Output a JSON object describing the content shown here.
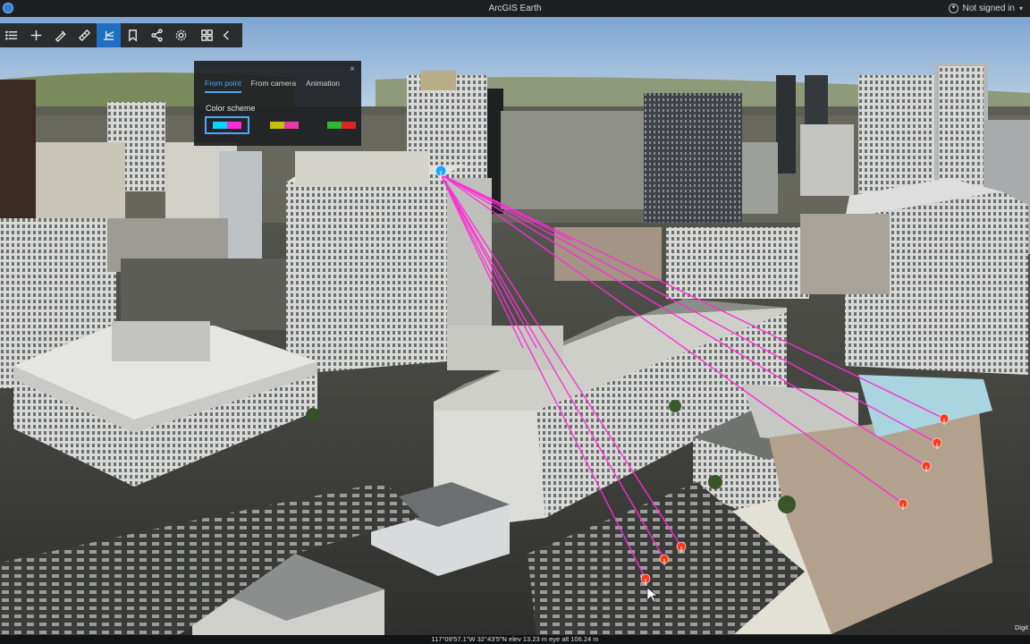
{
  "app": {
    "title": "ArcGIS Earth",
    "user_label": "Not signed in"
  },
  "toolbar": {
    "items": [
      {
        "name": "list-icon",
        "active": false
      },
      {
        "name": "add-icon",
        "active": false
      },
      {
        "name": "draw-icon",
        "active": false
      },
      {
        "name": "measure-icon",
        "active": false
      },
      {
        "name": "line-of-sight-icon",
        "active": true
      },
      {
        "name": "bookmark-icon",
        "active": false
      },
      {
        "name": "share-icon",
        "active": false
      },
      {
        "name": "settings-icon",
        "active": false
      },
      {
        "name": "apps-grid-icon",
        "active": false
      },
      {
        "name": "collapse-chevron-icon",
        "active": false
      }
    ]
  },
  "los_panel": {
    "close_glyph": "×",
    "tabs": [
      "From point",
      "From camera",
      "Animation"
    ],
    "active_tab": 0,
    "color_scheme_label": "Color scheme",
    "swatches": [
      {
        "colors": [
          "#00d8ff",
          "#ff2bd6"
        ],
        "selected": true
      },
      {
        "colors": [
          "#c8c000",
          "#e63aa8"
        ],
        "selected": false
      },
      {
        "colors": [
          "#2fb82f",
          "#e02424"
        ],
        "selected": false
      }
    ]
  },
  "status": {
    "coords": "117°09'57.1\"W 32°43'5\"N   elev 13.23 m   eye alt 106.24 m",
    "attribution": "Digit"
  },
  "colors": {
    "accent": "#1f6fc2",
    "sight_line": "#ff2bd6",
    "observer": "#1fa4ff",
    "target": "#ff3a1a"
  }
}
